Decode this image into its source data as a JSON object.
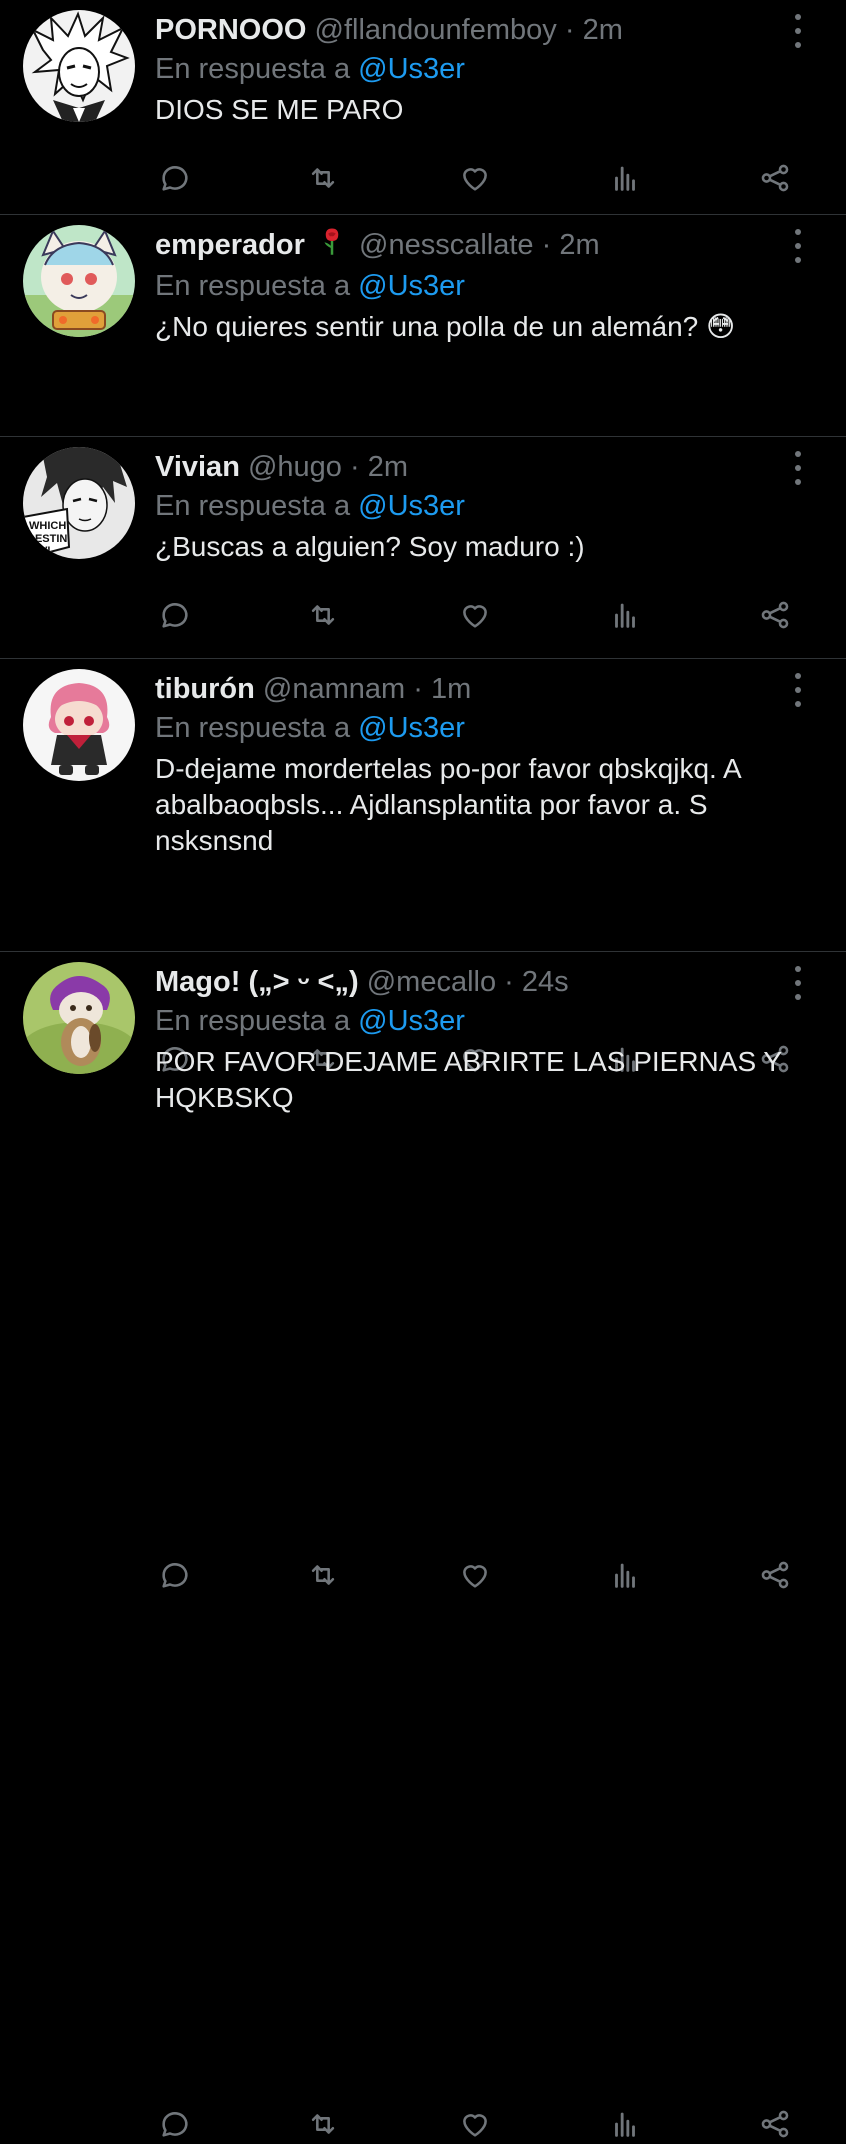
{
  "colors": {
    "background": "#000000",
    "text": "#e7e9ea",
    "muted": "#71767b",
    "mention": "#1d9bf0",
    "divider": "#2f3336"
  },
  "reply_prefix": "En respuesta a",
  "tweets": [
    {
      "name": "PORNOOO",
      "handle": "@fllandounfemboy",
      "time": "2m",
      "reply_to": "@Us3er",
      "text": "DIOS SE ME PARO",
      "avatar_icon": "manga-character-avatar"
    },
    {
      "name": "emperador",
      "name_emoji": "rose-emoji",
      "handle": "@nesscallate",
      "time": "2m",
      "reply_to": "@Us3er",
      "text": "¿No quieres sentir una polla de un alemán? 😳",
      "avatar_icon": "cartoon-character-avatar"
    },
    {
      "name": "Vivian",
      "handle": "@hugo",
      "time": "2m",
      "reply_to": "@Us3er",
      "text": "¿Buscas a alguien? Soy maduro :)",
      "avatar_icon": "manga-panel-avatar",
      "avatar_text": "WHICH DESTIN WI"
    },
    {
      "name": "tiburón",
      "handle": "@namnam",
      "time": "1m",
      "reply_to": "@Us3er",
      "text": "D-dejame mordertelas po-por favor qbskqjkq. A abalbaoqbsls... Ajdlansplantita por favor a. S nsksnsnd",
      "avatar_icon": "plush-doll-avatar"
    },
    {
      "name": "Mago!",
      "name_kaomoji": "(„> ᵕ <„)",
      "handle": "@mecallo",
      "time": "24s",
      "reply_to": "@Us3er",
      "text": "POR FAVOR DEJAME ABRIRTE LAS PIERNAS Y HQKBSKQ",
      "avatar_icon": "cat-photo-avatar"
    }
  ]
}
